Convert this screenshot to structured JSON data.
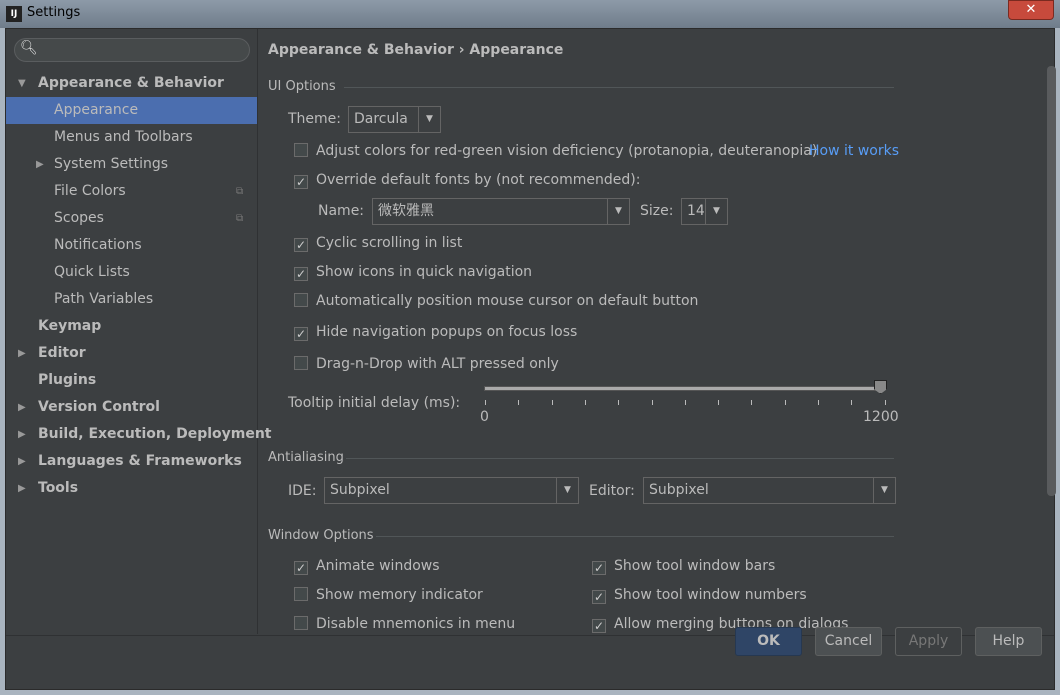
{
  "window": {
    "title": "Settings",
    "icon": "IJ",
    "close": "✕"
  },
  "search": {
    "placeholder": "",
    "icon": "search-icon"
  },
  "sidebar": {
    "items": [
      {
        "label": "Appearance & Behavior",
        "bold": true,
        "expanded": true
      },
      {
        "label": "Appearance",
        "selected": true
      },
      {
        "label": "Menus and Toolbars"
      },
      {
        "label": "System Settings",
        "collapsed": true
      },
      {
        "label": "File Colors"
      },
      {
        "label": "Scopes"
      },
      {
        "label": "Notifications"
      },
      {
        "label": "Quick Lists"
      },
      {
        "label": "Path Variables"
      },
      {
        "label": "Keymap",
        "bold": true
      },
      {
        "label": "Editor",
        "bold": true
      },
      {
        "label": "Plugins",
        "bold": true
      },
      {
        "label": "Version Control",
        "bold": true
      },
      {
        "label": "Build, Execution, Deployment",
        "bold": true
      },
      {
        "label": "Languages & Frameworks",
        "bold": true
      },
      {
        "label": "Tools",
        "bold": true
      }
    ]
  },
  "breadcrumb": "Appearance & Behavior › Appearance",
  "ui_options": {
    "title": "UI Options",
    "theme_label": "Theme:",
    "theme_value": "Darcula",
    "adjust_colors": {
      "label": "Adjust colors for red-green vision deficiency (protanopia, deuteranopia)",
      "checked": false
    },
    "how_it_works": "How it works",
    "override_fonts": {
      "label": "Override default fonts by (not recommended):",
      "checked": true
    },
    "name_label": "Name:",
    "name_value": "微软雅黑",
    "size_label": "Size:",
    "size_value": "14",
    "cyclic": {
      "label": "Cyclic scrolling in list",
      "checked": true
    },
    "show_icons": {
      "label": "Show icons in quick navigation",
      "checked": true
    },
    "auto_mouse": {
      "label": "Automatically position mouse cursor on default button",
      "checked": false
    },
    "hide_popups": {
      "label": "Hide navigation popups on focus loss",
      "checked": true
    },
    "dnd_alt": {
      "label": "Drag-n-Drop with ALT pressed only",
      "checked": false
    },
    "tooltip_label": "Tooltip initial delay (ms):",
    "tooltip_min": "0",
    "tooltip_max": "1200",
    "tooltip_value": 1200
  },
  "antialiasing": {
    "title": "Antialiasing",
    "ide_label": "IDE:",
    "ide_value": "Subpixel",
    "editor_label": "Editor:",
    "editor_value": "Subpixel"
  },
  "window_options": {
    "title": "Window Options",
    "left": [
      {
        "label": "Animate windows",
        "checked": true
      },
      {
        "label": "Show memory indicator",
        "checked": false
      },
      {
        "label": "Disable mnemonics in menu",
        "checked": false
      }
    ],
    "right": [
      {
        "label": "Show tool window bars",
        "checked": true
      },
      {
        "label": "Show tool window numbers",
        "checked": true
      },
      {
        "label": "Allow merging buttons on dialogs",
        "checked": true
      }
    ]
  },
  "buttons": {
    "ok": "OK",
    "cancel": "Cancel",
    "apply": "Apply",
    "help": "Help"
  },
  "colors": {
    "selection": "#4b6eaf",
    "link": "#589df6",
    "background": "#3c3f41"
  }
}
